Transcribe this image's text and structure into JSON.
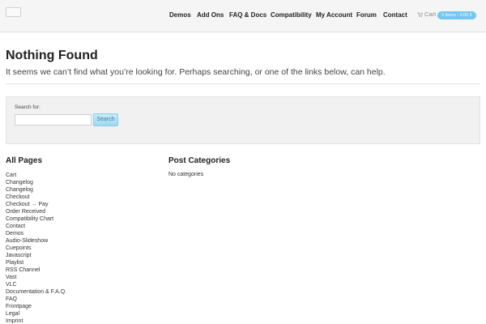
{
  "header": {
    "nav": [
      {
        "label": "Demos"
      },
      {
        "label": "Add Ons"
      },
      {
        "label": "FAQ & Docs"
      },
      {
        "label": "Compatibility"
      },
      {
        "label": "My Account"
      },
      {
        "label": "Forum"
      },
      {
        "label": "Contact"
      }
    ],
    "cart": {
      "label": "Cart",
      "badge": "0 items - 0.00 €",
      "icon": "cart-icon"
    }
  },
  "main": {
    "title": "Nothing Found",
    "message": "It seems we can’t find what you’re looking for. Perhaps searching, or one of the links below, can help."
  },
  "search": {
    "label": "Search for:",
    "value": "",
    "placeholder": "",
    "button_label": "Search"
  },
  "all_pages": {
    "heading": "All Pages",
    "items": [
      "Cart",
      "Changelog",
      "Changelog",
      "Checkout",
      "Checkout → Pay",
      "Order Received",
      "Compatibility Chart",
      "Contact",
      "Demos",
      "Audio-Slideshow",
      "Cuepoints",
      "Javascript",
      "Playlist",
      "RSS Channel",
      "Vast",
      "VLC",
      "Documentation & F.A.Q.",
      "FAQ",
      "Frontpage",
      "Legal",
      "Imprint"
    ]
  },
  "post_categories": {
    "heading": "Post Categories",
    "empty_text": "No categories"
  },
  "colors": {
    "accent": "#74c5f0",
    "header_bg": "#f5f5f5",
    "button_text": "#3a7ea0"
  }
}
